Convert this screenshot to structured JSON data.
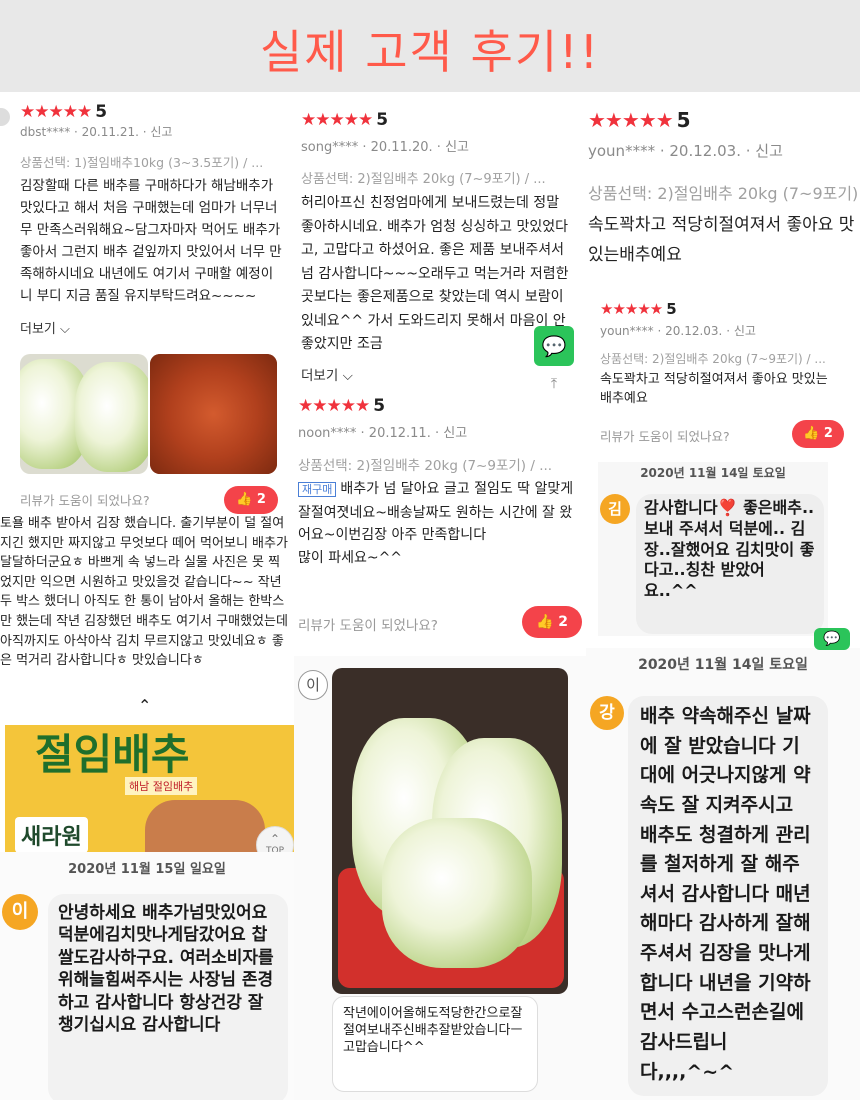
{
  "header": {
    "title": "실제 고객 후기!!"
  },
  "review1": {
    "score": "5",
    "author": "dbst****",
    "date": "20.11.21.",
    "report": "신고",
    "option": "상품선택: 1)절임배추10kg (3~3.5포기) / ...",
    "body": "김장할때 다른 배추를 구매하다가 해남배추가 맛있다고 해서 처음 구매했는데 엄마가 너무너무 만족스러워해요~담그자마자 먹어도 배추가 좋아서 그런지 배추 겉잎까지 맛있어서 너무 만족해하시네요 내년에도 여기서 구매할 예정이니 부디 지금 품질 유지부탁드려요~~~~",
    "more": "더보기",
    "helpful": "리뷰가 도움이 되었나요?",
    "likes": "2"
  },
  "review2": {
    "score": "5",
    "author": "song****",
    "date": "20.11.20.",
    "report": "신고",
    "option": "상품선택: 2)절임배추 20kg (7~9포기) / ...",
    "body": "허리아프신 친정엄마에게 보내드렸는데 정말 좋아하시네요. 배추가 엄청 싱싱하고 맛있었다고, 고맙다고 하셨어요. 좋은 제품 보내주셔서 넘 감사합니다~~~오래두고 먹는거라 저렴한곳보다는 좋은제품으로 찾았는데 역시 보람이 있네요^^ 가서 도와드리지 못해서 마음이 안좋았지만 조금",
    "more": "더보기"
  },
  "review3": {
    "score": "5",
    "author": "youn****",
    "date": "20.12.03.",
    "report": "신고",
    "option": "상품선택: 2)절임배추 20kg (7~9포기) / ...",
    "body": "속도꽉차고 적당히절여져서 좋아요 맛있는배추예요"
  },
  "review3b": {
    "score": "5",
    "author": "youn****",
    "date": "20.12.03.",
    "report": "신고",
    "option": "상품선택: 2)절임배추 20kg (7~9포기) / ...",
    "body": "속도꽉차고 적당히절여져서 좋아요 맛있는배추예요",
    "helpful": "리뷰가 도움이 되었나요?",
    "likes": "2"
  },
  "review4": {
    "score": "5",
    "author": "noon****",
    "date": "20.12.11.",
    "report": "신고",
    "option": "상품선택: 2)절임배추 20kg (7~9포기) / ...",
    "badge": "재구매",
    "body": "배추가 넘 달아요 글고 절임도 딱 알맞게 잘절여졋네요~배송날짜도 원하는 시간에 잘 왔어요~이번김장 아주 만족합니다",
    "body2": "많이 파세요~^^",
    "helpful": "리뷰가 도움이 되었나요?",
    "likes": "2"
  },
  "review5": {
    "body": "토욜 배추 받아서 김장 했습니다. 출기부분이 덜 절여지긴 했지만 짜지않고 무엇보다 떼어 먹어보니 배추가 달달하더군요ㅎ 바쁘게 속 넣느라 실물 사진은 못 찍었지만 익으면 시원하고 맛있을것 같습니다~~ 작년 두 박스 했더니 아직도 한 통이 남아서 올해는 한박스만 했는데 작년 김장했던 배추도 여기서 구매했었는데 아직까지도 아삭아삭 김치 무르지않고 맛있네요ㅎ 좋은 먹거리 감사합니다ㅎ 맛있습니다ㅎ"
  },
  "package": {
    "line1": "절임배추",
    "line2": "해남 절임배추",
    "brand": "새라원"
  },
  "top_label": "TOP",
  "chat1": {
    "date": "2020년 11월 14일 토요일",
    "avatar": "김",
    "message": "감사합니다❣️ 좋은배추..보내 주셔서 덕분에.. 김장..잘했어요 김치맛이 좋다고..칭찬 받았어요..^^"
  },
  "chat2": {
    "date": "2020년 11월 15일 일요일",
    "avatar": "이",
    "message": "안녕하세요 배추가넘맛있어요 덕분에김치맛나게담갔어요 찹쌀도감사하구요. 여러소비자를위해늘힘써주시는 사장님 존경하고 감사합니다 항상건강 잘 챙기십시요 감사합니다"
  },
  "chat3": {
    "avatar": "이",
    "message": "작년에이어올해도적당한간으로잘절여보내주신배추잘받았습니다ㅡ 고맙습니다^^"
  },
  "chat4": {
    "date": "2020년 11월 14일 토요일",
    "avatar": "강",
    "message": "배추 약속해주신 날짜에 잘 받았습니다 기대에 어긋나지않게 약속도 잘 지켜주시고 배추도 청결하게 관리를 철저하게 잘 해주셔서 감사합니다 매년해마다 감사하게 잘해주셔서 김장을 맛나게 합니다 내년을 기약하면서 수고스런손길에 감사드립니다,,,,^~^"
  },
  "colors": {
    "accent": "#f4434a",
    "title": "#ff5a4a",
    "avatar": "#f5a623",
    "green": "#2bc45a"
  }
}
